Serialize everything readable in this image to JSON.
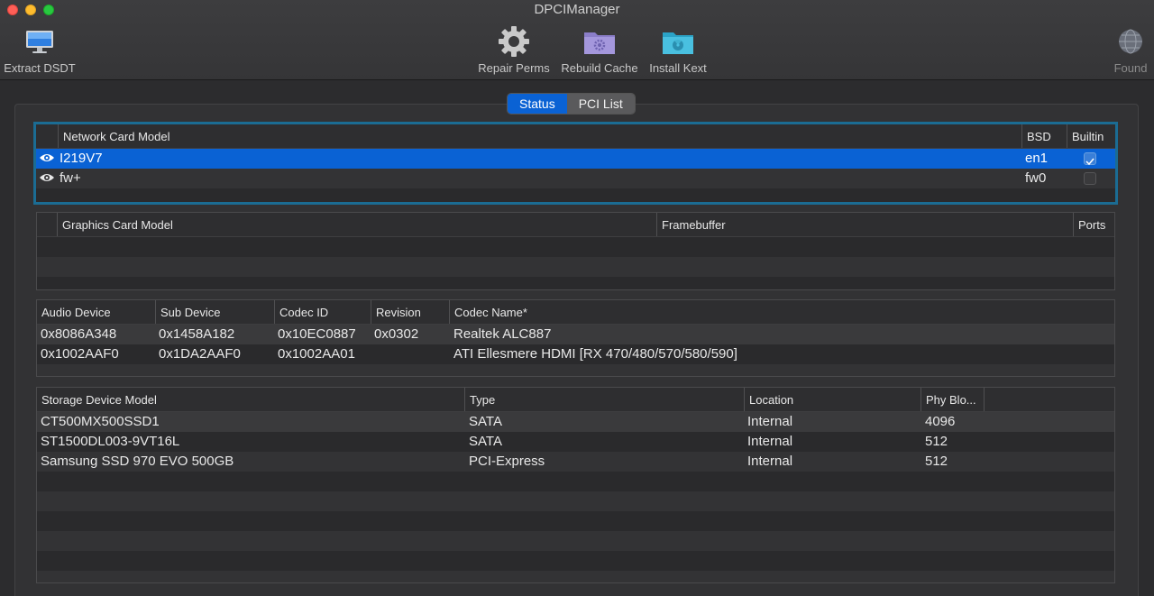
{
  "window": {
    "title": "DPCIManager"
  },
  "toolbar": {
    "extract_label": "Extract DSDT",
    "repair_label": "Repair Perms",
    "rebuild_label": "Rebuild Cache",
    "install_label": "Install Kext",
    "found_label": "Found",
    "icons": {
      "extract": "monitor-icon",
      "repair": "gear-icon",
      "rebuild": "folder-gear-icon",
      "install": "folder-radiation-icon",
      "found": "globe-icon"
    }
  },
  "tabs": [
    {
      "label": "Status",
      "active": true
    },
    {
      "label": "PCI List",
      "active": false
    }
  ],
  "network": {
    "headers": {
      "model": "Network Card Model",
      "bsd": "BSD",
      "builtin": "Builtin"
    },
    "rows": [
      {
        "model": "I219V7",
        "bsd": "en1",
        "builtin": true,
        "selected": true
      },
      {
        "model": "fw+",
        "bsd": "fw0",
        "builtin": false,
        "selected": false
      }
    ]
  },
  "graphics": {
    "headers": {
      "model": "Graphics Card Model",
      "framebuffer": "Framebuffer",
      "ports": "Ports"
    },
    "rows": []
  },
  "audio": {
    "headers": {
      "device": "Audio Device",
      "sub": "Sub Device",
      "codec": "Codec ID",
      "revision": "Revision",
      "name": "Codec Name*"
    },
    "rows": [
      {
        "device": "0x8086A348",
        "sub": "0x1458A182",
        "codec": "0x10EC0887",
        "revision": "0x0302",
        "name": "Realtek ALC887"
      },
      {
        "device": "0x1002AAF0",
        "sub": "0x1DA2AAF0",
        "codec": "0x1002AA01",
        "revision": "",
        "name": "ATI Ellesmere HDMI [RX 470/480/570/580/590]"
      }
    ]
  },
  "storage": {
    "headers": {
      "model": "Storage Device Model",
      "type": "Type",
      "location": "Location",
      "block": "Phy Blo..."
    },
    "rows": [
      {
        "model": "CT500MX500SSD1",
        "type": "SATA",
        "location": "Internal",
        "block": "4096"
      },
      {
        "model": "ST1500DL003-9VT16L",
        "type": "SATA",
        "location": "Internal",
        "block": "512"
      },
      {
        "model": "Samsung SSD 970 EVO 500GB",
        "type": "PCI-Express",
        "location": "Internal",
        "block": "512"
      }
    ]
  },
  "colors": {
    "accent": "#0a62d4",
    "focus_ring": "#1b6c93",
    "background": "#2c2c2e"
  }
}
